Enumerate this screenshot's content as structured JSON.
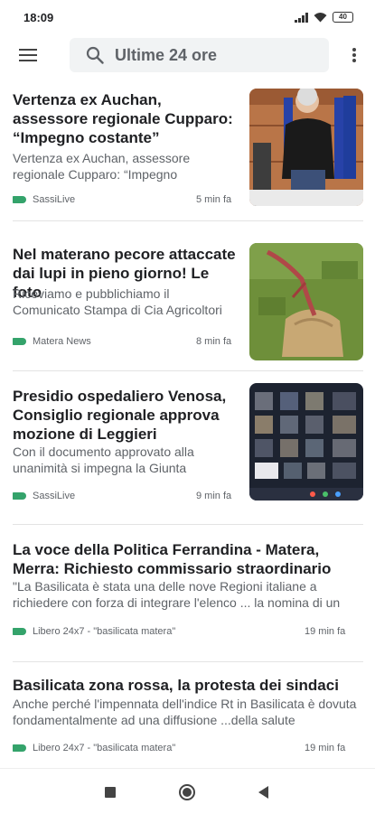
{
  "status_bar": {
    "time": "18:09",
    "battery": "40",
    "icons": [
      "signal-icon",
      "wifi-icon",
      "battery-icon"
    ]
  },
  "app_bar": {
    "search_text": "Ultime 24 ore",
    "icons": [
      "menu-icon",
      "search-icon",
      "more-vert-icon"
    ]
  },
  "colors": {
    "source_tag": "#34a36b",
    "search_bg": "#f1f3f4",
    "title_text": "#202124",
    "secondary_text": "#5f6368"
  },
  "articles": [
    {
      "title": "Vertenza ex Auchan, assessore regionale Cupparo: “Impegno costante”",
      "snippet": "Vertenza ex Auchan, assessore regionale Cupparo: “Impegno",
      "source": "SassiLive",
      "time": "5 min fa",
      "has_thumbnail": true
    },
    {
      "title": "Nel materano pecore attaccate dai lupi in pieno giorno! Le foto",
      "snippet": "Riceviamo e pubblichiamo il Comunicato Stampa di Cia Agricoltori",
      "source": "Matera News",
      "time": "8 min fa",
      "has_thumbnail": true
    },
    {
      "title": "Presidio ospedaliero Venosa, Consiglio regionale approva mozione di Leggieri",
      "snippet": "Con il documento approvato alla unanimità si impegna la Giunta",
      "source": "SassiLive",
      "time": "9 min fa",
      "has_thumbnail": true
    },
    {
      "title": "La voce della Politica Ferrandina - Matera, Merra: Richiesto commissario straordinario",
      "snippet": "\"La Basilicata è stata una delle nove Regioni italiane a richiedere con forza di integrare l'elenco ... la nomina di un",
      "source": "Libero 24x7 - \"basilicata matera\"",
      "time": "19 min fa",
      "has_thumbnail": false
    },
    {
      "title": "Basilicata zona rossa, la protesta dei sindaci",
      "snippet": "Anche perché l'impennata dell'indice Rt in Basilicata è dovuta fondamentalmente ad una diffusione ...della salute",
      "source": "Libero 24x7 - \"basilicata matera\"",
      "time": "19 min fa",
      "has_thumbnail": false
    }
  ],
  "nav_bar": {
    "icons": [
      "recent-apps-icon",
      "home-icon",
      "back-icon"
    ]
  }
}
